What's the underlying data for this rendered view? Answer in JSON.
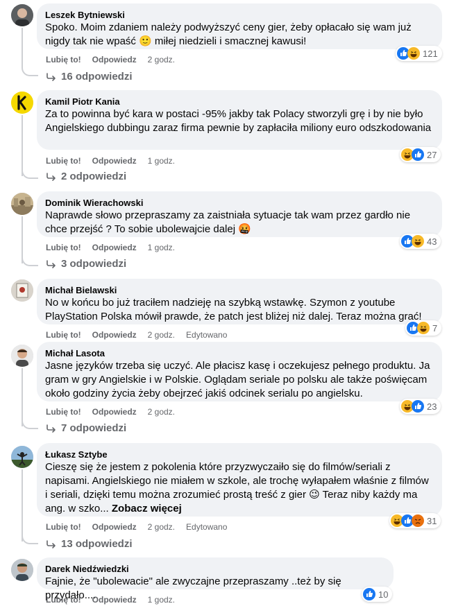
{
  "labels": {
    "like": "Lubię to!",
    "reply": "Odpowiedz",
    "edited": "Edytowano"
  },
  "comments": [
    {
      "author": "Leszek Bytniewski",
      "text": "Spoko. Moim zdaniem należy podwyższyć ceny gier, żeby opłacało się wam już nigdy tak nie wpaść 🙂 miłej niedzieli i smacznej kawusi!",
      "time": "2 godz.",
      "reaction_count": "121",
      "reaction_icons": [
        "like",
        "haha"
      ],
      "replies": "16 odpowiedzi"
    },
    {
      "author": "Kamil Piotr Kania",
      "text": "Za to powinna być kara w postaci -95% jakby tak Polacy stworzyli grę i by nie było Angielskiego dubbingu zaraz firma pewnie by zapłaciła miliony euro odszkodowania",
      "time": "1 godz.",
      "reaction_count": "27",
      "reaction_icons": [
        "haha",
        "like"
      ],
      "replies": "2 odpowiedzi"
    },
    {
      "author": "Dominik Wierachowski",
      "text": "Naprawde słowo przepraszamy za zaistniała sytuacje tak wam przez gardło nie chce przejść ? To sobie ubolewajcie dalej 🤬",
      "time": "1 godz.",
      "reaction_count": "43",
      "reaction_icons": [
        "like",
        "haha"
      ],
      "replies": "3 odpowiedzi"
    },
    {
      "author": "Michał Bielawski",
      "text": "No w końcu bo już traciłem nadzieję na szybką wstawkę. Szymon z youtube PlayStation Polska mówił prawde, że patch jest bliżej niż dalej. Teraz można grać!",
      "time": "2 godz.",
      "edited": true,
      "reaction_count": "7",
      "reaction_icons": [
        "like",
        "haha"
      ],
      "replies": ""
    },
    {
      "author": "Michał Lasota",
      "text": "Jasne języków trzeba się uczyć. Ale płacisz kasę i oczekujesz pełnego produktu. Ja gram w gry Angielskie i w Polskie. Oglądam seriale po polsku ale także poświęcam około godziny życia żeby obejrzeć jakiś odcinek serialu po angielsku.",
      "time": "2 godz.",
      "reaction_count": "23",
      "reaction_icons": [
        "haha",
        "like"
      ],
      "replies": "7 odpowiedzi"
    },
    {
      "author": "Łukasz Sztybe",
      "text": "Cieszę się że jestem z pokolenia które przyzwyczaiło się do filmów/seriali z napisami. Angielskiego nie miałem w szkole, ale trochę wyłapałem właśnie z filmów i seriali, dzięki temu można zrozumieć prostą treść z gier 😉 Teraz niby każdy ma ang. w szko...",
      "see_more": "Zobacz więcej",
      "time": "2 godz.",
      "edited": true,
      "reaction_count": "31",
      "reaction_icons": [
        "haha",
        "like",
        "angry"
      ],
      "replies": "13 odpowiedzi"
    },
    {
      "author": "Darek Niedźwiedzki",
      "text": "Fajnie, że \"ubolewacie\" ale zwyczajne przepraszamy ..też by się przydało....",
      "time": "1 godz.",
      "reaction_count": "10",
      "reaction_icons": [
        "like"
      ],
      "replies": ""
    }
  ],
  "colors": {
    "bubble": "#f0f2f5",
    "secondary_text": "#65676b",
    "like_blue": "#1877f2",
    "haha_yellow": "#f7b928",
    "angry_orange": "#e9710f"
  }
}
